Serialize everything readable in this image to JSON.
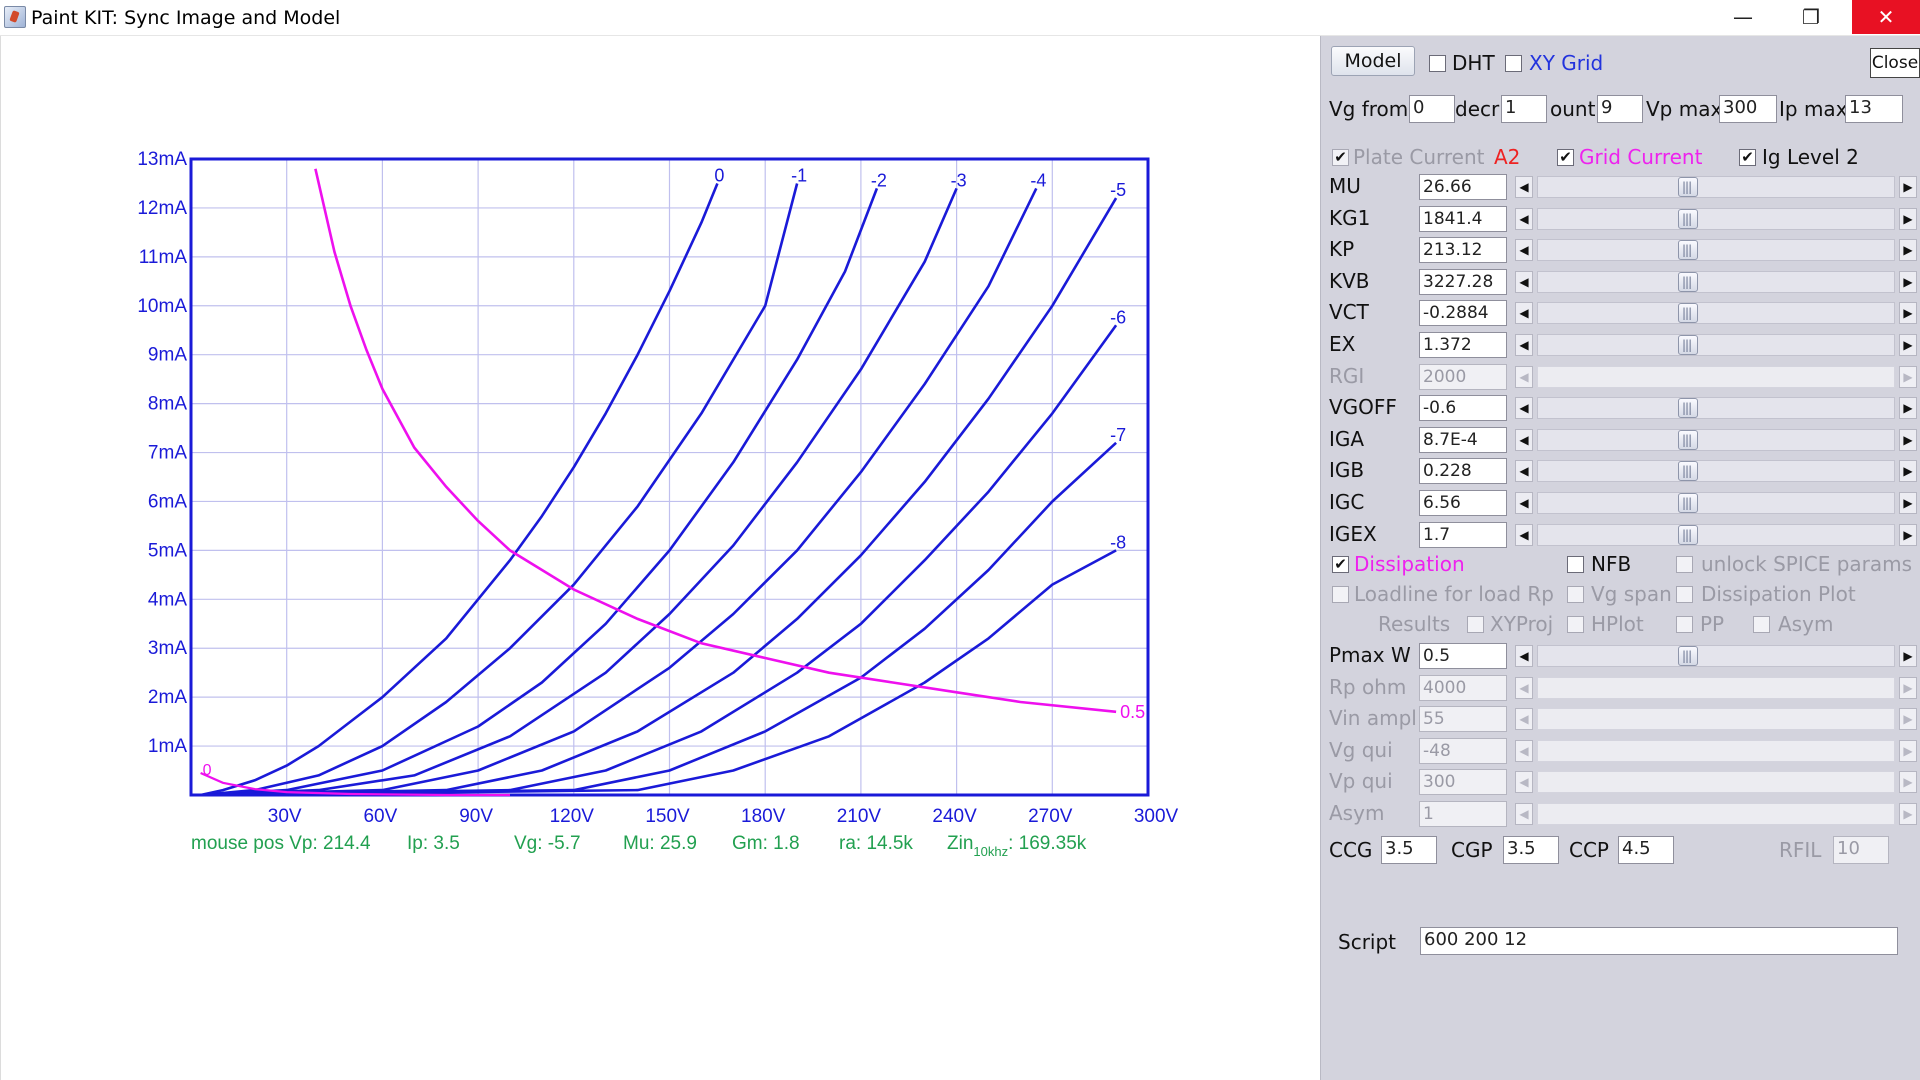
{
  "window": {
    "title": "Paint KIT: Sync Image and Model",
    "minimize_glyph": "—",
    "maximize_glyph": "❐",
    "close_glyph": "✕"
  },
  "chart_data": {
    "type": "line",
    "xlabel": "",
    "ylabel": "",
    "xlim": [
      0,
      300
    ],
    "ylim": [
      0,
      13
    ],
    "x_ticks": [
      "30V",
      "60V",
      "90V",
      "120V",
      "150V",
      "180V",
      "210V",
      "240V",
      "270V",
      "300V"
    ],
    "y_ticks": [
      "1mA",
      "2mA",
      "3mA",
      "4mA",
      "5mA",
      "6mA",
      "7mA",
      "8mA",
      "9mA",
      "10mA",
      "11mA",
      "12mA",
      "13mA"
    ],
    "grid": true,
    "colors": {
      "axes": "#1a1ad8",
      "curves": "#1a1ad8",
      "grid": "#c0c0ee",
      "dissipation": "#ee10ee"
    },
    "series": [
      {
        "name": "0",
        "x": [
          3,
          10,
          20,
          30,
          40,
          50,
          60,
          70,
          80,
          90,
          100,
          110,
          120,
          130,
          140,
          150,
          160,
          165
        ],
        "y": [
          0.0,
          0.1,
          0.3,
          0.6,
          1.0,
          1.5,
          2.0,
          2.6,
          3.2,
          4.0,
          4.8,
          5.7,
          6.7,
          7.8,
          9.0,
          10.3,
          11.7,
          12.5
        ]
      },
      {
        "name": "-1",
        "x": [
          3,
          20,
          40,
          60,
          80,
          100,
          120,
          140,
          160,
          180,
          190
        ],
        "y": [
          0.0,
          0.1,
          0.4,
          1.0,
          1.9,
          3.0,
          4.3,
          5.9,
          7.8,
          10.0,
          12.5
        ]
      },
      {
        "name": "-2",
        "x": [
          3,
          30,
          60,
          90,
          110,
          130,
          150,
          170,
          190,
          205,
          215
        ],
        "y": [
          0.0,
          0.1,
          0.5,
          1.4,
          2.3,
          3.5,
          5.0,
          6.8,
          8.9,
          10.7,
          12.4
        ]
      },
      {
        "name": "-3",
        "x": [
          3,
          40,
          70,
          100,
          130,
          150,
          170,
          190,
          210,
          230,
          240
        ],
        "y": [
          0.0,
          0.1,
          0.4,
          1.2,
          2.5,
          3.7,
          5.1,
          6.8,
          8.7,
          10.9,
          12.4
        ]
      },
      {
        "name": "-4",
        "x": [
          3,
          60,
          90,
          120,
          150,
          170,
          190,
          210,
          230,
          250,
          265
        ],
        "y": [
          0.0,
          0.1,
          0.5,
          1.3,
          2.6,
          3.7,
          5.0,
          6.6,
          8.4,
          10.4,
          12.4
        ]
      },
      {
        "name": "-5",
        "x": [
          3,
          80,
          110,
          140,
          170,
          190,
          210,
          230,
          250,
          270,
          290
        ],
        "y": [
          0.0,
          0.1,
          0.5,
          1.3,
          2.5,
          3.6,
          4.9,
          6.4,
          8.1,
          10.0,
          12.2
        ]
      },
      {
        "name": "-6",
        "x": [
          3,
          100,
          130,
          160,
          190,
          210,
          230,
          250,
          270,
          290
        ],
        "y": [
          0.0,
          0.1,
          0.5,
          1.3,
          2.5,
          3.5,
          4.8,
          6.2,
          7.8,
          9.6
        ]
      },
      {
        "name": "-7",
        "x": [
          3,
          120,
          150,
          180,
          210,
          230,
          250,
          270,
          290
        ],
        "y": [
          0.0,
          0.1,
          0.5,
          1.3,
          2.4,
          3.4,
          4.6,
          6.0,
          7.2
        ]
      },
      {
        "name": "-8",
        "x": [
          3,
          140,
          170,
          200,
          230,
          250,
          270,
          290
        ],
        "y": [
          0.0,
          0.1,
          0.5,
          1.2,
          2.3,
          3.2,
          4.3,
          5.0
        ]
      }
    ],
    "dissipation_curve": {
      "label": "0.5",
      "x": [
        39,
        45,
        50,
        55,
        60,
        70,
        80,
        90,
        100,
        120,
        140,
        160,
        180,
        200,
        220,
        240,
        260,
        290
      ],
      "y": [
        12.8,
        11.1,
        10.0,
        9.1,
        8.3,
        7.1,
        6.3,
        5.6,
        5.0,
        4.2,
        3.6,
        3.1,
        2.8,
        2.5,
        2.3,
        2.1,
        1.9,
        1.7
      ]
    },
    "ig_curve": {
      "label": "0",
      "x": [
        3,
        10,
        20,
        30,
        50,
        80,
        100
      ],
      "y": [
        0.45,
        0.25,
        0.12,
        0.06,
        0.02,
        0.0,
        0.0
      ]
    }
  },
  "readout": {
    "mouse_pos": "mouse pos Vp: 214.4",
    "ip": "Ip: 3.5",
    "vg": "Vg: -5.7",
    "mu": "Mu: 25.9",
    "gm": "Gm: 1.8",
    "ra": "ra: 14.5k",
    "zin_prefix": "Zin",
    "zin_sub": "10khz",
    "zin_value": ": 169.35k"
  },
  "panel": {
    "model_button": "Model",
    "dht": {
      "label": "DHT",
      "checked": false
    },
    "xy_grid": {
      "label": "XY Grid",
      "checked": false
    },
    "close_button": "Close",
    "vg_from": {
      "label": "Vg from",
      "value": "0"
    },
    "decr": {
      "label": "decr",
      "value": "1"
    },
    "count": {
      "label": "ount",
      "value": "9"
    },
    "vp_max": {
      "label": "Vp max",
      "value": "300"
    },
    "ip_max": {
      "label": "Ip max",
      "value": "13"
    },
    "plate_current": {
      "label": "Plate Current",
      "checked": true,
      "tag": "A2"
    },
    "grid_current": {
      "label": "Grid Current",
      "checked": true
    },
    "ig_level": {
      "label": "Ig Level 2",
      "checked": true
    },
    "params": [
      {
        "name": "MU",
        "value": "26.66",
        "enabled": true
      },
      {
        "name": "KG1",
        "value": "1841.4",
        "enabled": true
      },
      {
        "name": "KP",
        "value": "213.12",
        "enabled": true
      },
      {
        "name": "KVB",
        "value": "3227.28",
        "enabled": true
      },
      {
        "name": "VCT",
        "value": "-0.2884",
        "enabled": true
      },
      {
        "name": "EX",
        "value": "1.372",
        "enabled": true
      },
      {
        "name": "RGI",
        "value": "2000",
        "enabled": false
      },
      {
        "name": "VGOFF",
        "value": "-0.6",
        "enabled": true
      },
      {
        "name": "IGA",
        "value": "8.7E-4",
        "enabled": true
      },
      {
        "name": "IGB",
        "value": "0.228",
        "enabled": true
      },
      {
        "name": "IGC",
        "value": "6.56",
        "enabled": true
      },
      {
        "name": "IGEX",
        "value": "1.7",
        "enabled": true
      }
    ],
    "dissipation": {
      "label": "Dissipation",
      "checked": true
    },
    "nfb": {
      "label": "NFB",
      "checked": false
    },
    "unlock_spice": {
      "label": "unlock SPICE params",
      "checked": false
    },
    "loadline": {
      "label": "Loadline for load Rp",
      "checked": false
    },
    "vg_span": {
      "label": "Vg span",
      "checked": false
    },
    "dissipation_plot": {
      "label": "Dissipation Plot",
      "checked": false
    },
    "results_label": "Results",
    "xyproj": {
      "label": "XYProj",
      "checked": false
    },
    "hplot": {
      "label": "HPlot",
      "checked": false
    },
    "pp": {
      "label": "PP",
      "checked": false
    },
    "asym_cb": {
      "label": "Asym",
      "checked": false
    },
    "params2": [
      {
        "name": "Pmax W",
        "value": "0.5",
        "enabled": true
      },
      {
        "name": "Rp ohm",
        "value": "4000",
        "enabled": false
      },
      {
        "name": "Vin ampl",
        "value": "55",
        "enabled": false
      },
      {
        "name": "Vg qui",
        "value": "-48",
        "enabled": false
      },
      {
        "name": "Vp qui",
        "value": "300",
        "enabled": false
      },
      {
        "name": "Asym",
        "value": "1",
        "enabled": false
      }
    ],
    "ccg": {
      "label": "CCG",
      "value": "3.5"
    },
    "cgp": {
      "label": "CGP",
      "value": "3.5"
    },
    "ccp": {
      "label": "CCP",
      "value": "4.5"
    },
    "rfil": {
      "label": "RFIL",
      "value": "10"
    },
    "script": {
      "label": "Script",
      "value": "600 200 12"
    },
    "check_glyph": "✔",
    "arrow_left": "◀",
    "arrow_right": "▶"
  }
}
